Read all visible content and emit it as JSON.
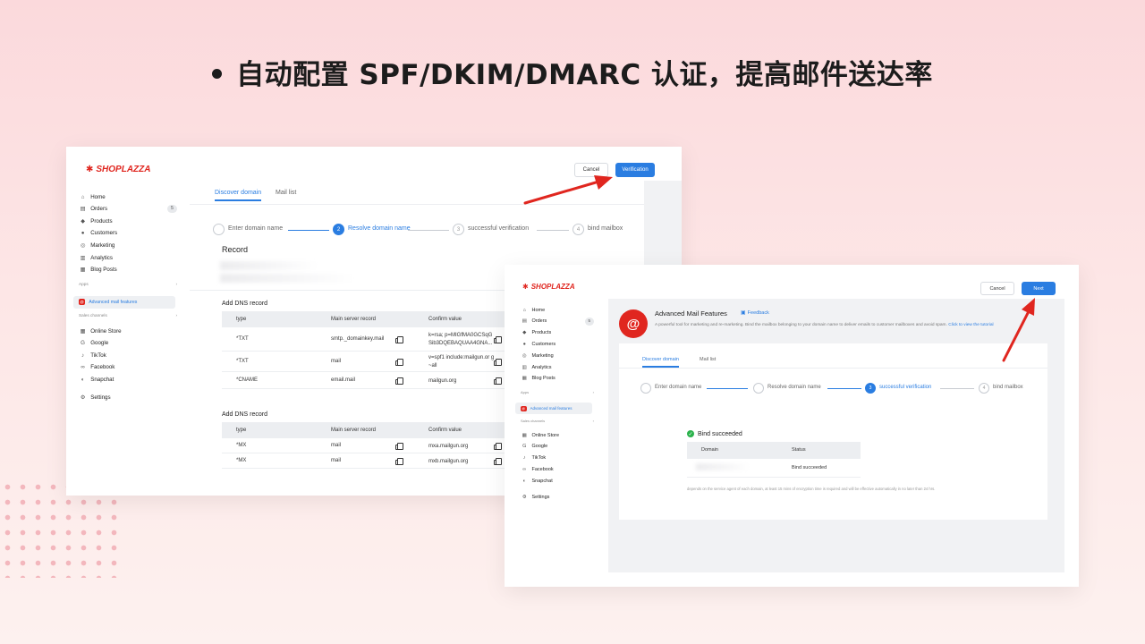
{
  "headline": "自动配置 SPF/DKIM/DMARC 认证，提高邮件送达率",
  "brand": "SHOPLAZZA",
  "colors": {
    "accent": "#2a7de1",
    "brand": "#e0261f",
    "arrow": "#e0261f",
    "success": "#2bb24c"
  },
  "nav": {
    "items": [
      {
        "label": "Home",
        "icon": "home-icon"
      },
      {
        "label": "Orders",
        "icon": "orders-icon",
        "badge": "5"
      },
      {
        "label": "Products",
        "icon": "tag-icon"
      },
      {
        "label": "Customers",
        "icon": "user-icon"
      },
      {
        "label": "Marketing",
        "icon": "marketing-icon"
      },
      {
        "label": "Analytics",
        "icon": "chart-icon"
      },
      {
        "label": "Blog Posts",
        "icon": "blog-icon"
      }
    ],
    "apps_label": "Apps",
    "app_item": "Advanced mail features",
    "sales_label": "Sales channels",
    "channels": [
      {
        "label": "Online Store",
        "icon": "store-icon"
      },
      {
        "label": "Google",
        "icon": "google-icon"
      },
      {
        "label": "TikTok",
        "icon": "tiktok-icon"
      },
      {
        "label": "Facebook",
        "icon": "facebook-icon"
      },
      {
        "label": "Snapchat",
        "icon": "snapchat-icon"
      }
    ],
    "settings": "Settings"
  },
  "tabs": {
    "discover": "Discover domain",
    "mail_list": "Mail list"
  },
  "steps": [
    {
      "num": "1",
      "label": "Enter domain name"
    },
    {
      "num": "2",
      "label": "Resolve domain name"
    },
    {
      "num": "3",
      "label": "successful verification"
    },
    {
      "num": "4",
      "label": "bind mailbox"
    }
  ],
  "screen1": {
    "cancel": "Cancel",
    "verify": "Verification",
    "current_step": 2,
    "record_title": "Record",
    "table1_title": "Add DNS record",
    "table2_title": "Add DNS record",
    "columns": [
      "type",
      "Main server record",
      "Confirm value"
    ],
    "rows1": [
      {
        "type": "*TXT",
        "main": "smtp._domainkey.mail",
        "confirm": "k=rsa; p=MIGfMA0GCSqG Sib3DQEBAQUAA4GNA..."
      },
      {
        "type": "*TXT",
        "main": "mail",
        "confirm": "v=spf1 include:mailgun.or g ~all"
      },
      {
        "type": "*CNAME",
        "main": "email.mail",
        "confirm": "mailgun.org"
      }
    ],
    "rows2": [
      {
        "type": "*MX",
        "main": "mail",
        "confirm": "mxa.mailgun.org"
      },
      {
        "type": "*MX",
        "main": "mail",
        "confirm": "mxb.mailgun.org"
      }
    ]
  },
  "screen2": {
    "cancel": "Cancel",
    "next": "Next",
    "current_step": 3,
    "app_title": "Advanced Mail Features",
    "feedback": "Feedback",
    "description": "A powerful tool for marketing and re-marketing. Bind the mailbox belonging to your domain name to deliver emails to customer mailboxes and avoid spam.",
    "tutorial_link": "Click to view the tutorial",
    "bind_title": "Bind succeeded",
    "columns": [
      "Domain",
      "Status"
    ],
    "status_value": "Bind succeeded",
    "note": "depends on the service agent of each domain, at least 15 mins of encryption time is required and will be effective automatically in no later than 24 hrs."
  }
}
